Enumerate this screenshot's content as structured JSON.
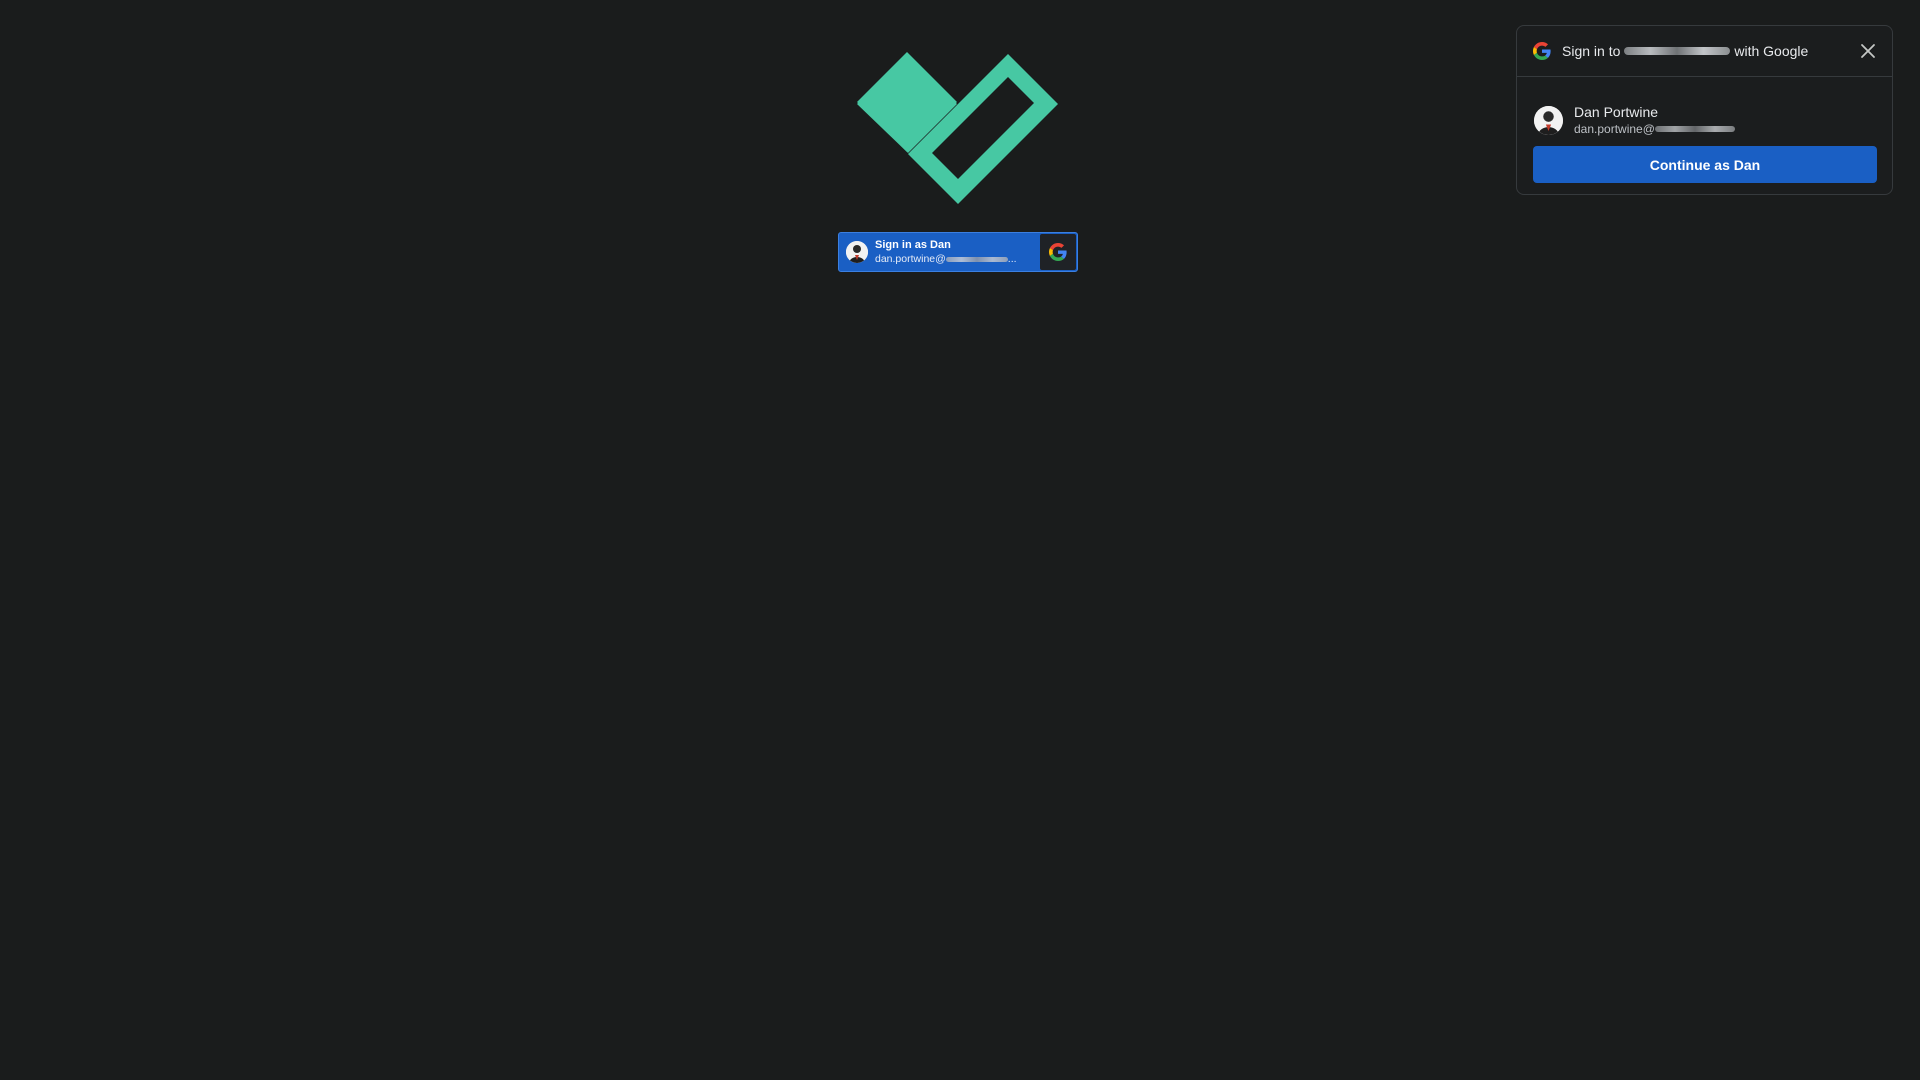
{
  "logo": {
    "icon": "checkmark-heart-logo",
    "color": "#47c8a3"
  },
  "signin_button": {
    "title": "Sign in as Dan",
    "email_prefix": "dan.portwine@",
    "email_suffix": "...",
    "background": "#1a5fc4"
  },
  "onetap": {
    "title_prefix": "Sign in to",
    "title_suffix": "with Google",
    "account": {
      "name": "Dan Portwine",
      "email_prefix": "dan.portwine@"
    },
    "continue_label": "Continue as Dan",
    "accent": "#1a5fc4"
  }
}
